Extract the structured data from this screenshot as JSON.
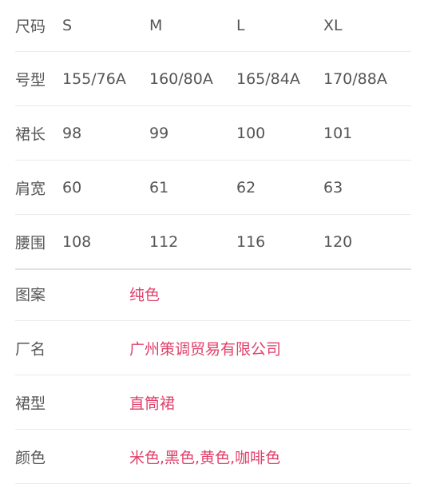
{
  "size_table": {
    "rows": [
      {
        "label": "尺码",
        "cells": [
          "S",
          "M",
          "L",
          "XL"
        ]
      },
      {
        "label": "号型",
        "cells": [
          "155/76A",
          "160/80A",
          "165/84A",
          "170/88A"
        ]
      },
      {
        "label": "裙长",
        "cells": [
          "98",
          "99",
          "100",
          "101"
        ]
      },
      {
        "label": "肩宽",
        "cells": [
          "60",
          "61",
          "62",
          "63"
        ]
      },
      {
        "label": "腰围",
        "cells": [
          "108",
          "112",
          "116",
          "120"
        ]
      }
    ]
  },
  "attributes": [
    {
      "label": "图案",
      "value": "纯色"
    },
    {
      "label": "厂名",
      "value": "广州策调贸易有限公司"
    },
    {
      "label": "裙型",
      "value": "直筒裙"
    },
    {
      "label": "颜色",
      "value": "米色,黑色,黄色,咖啡色"
    }
  ],
  "colors": {
    "label_text": "#555555",
    "accent_value": "#e0406a",
    "divider": "#ebebeb"
  }
}
